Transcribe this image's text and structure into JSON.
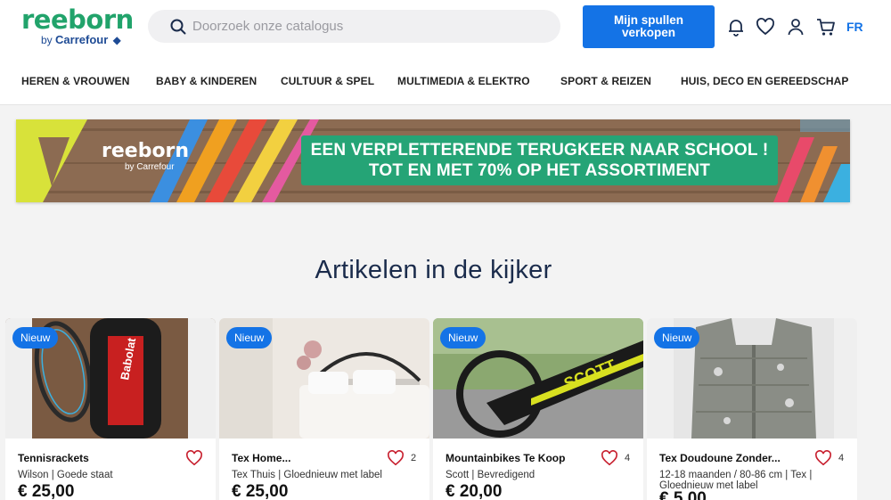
{
  "header": {
    "logo_main": "reeborn",
    "logo_by": "by",
    "logo_brand": "Carrefour",
    "search_placeholder": "Doorzoek onze catalogus",
    "sell_button": "Mijn spullen verkopen",
    "lang": "FR",
    "icons": [
      "bell-icon",
      "heart-icon",
      "user-icon",
      "cart-icon"
    ]
  },
  "nav": {
    "items": [
      "HEREN & VROUWEN",
      "BABY & KINDEREN",
      "CULTUUR & SPEL",
      "MULTIMEDIA & ELEKTRO",
      "SPORT & REIZEN",
      "HUIS, DECO EN GEREEDSCHAP"
    ]
  },
  "banner": {
    "logo_main": "reeborn",
    "logo_sub": "by Carrefour",
    "line1": "EEN VERPLETTERENDE TERUGKEER NAAR SCHOOL !",
    "line2": "TOT EN MET 70% OP HET ASSORTIMENT"
  },
  "section": {
    "title": "Artikelen in de kijker"
  },
  "products": [
    {
      "badge": "Nieuw",
      "title": "Tennisrackets",
      "subtitle": "Wilson | Goede staat",
      "price": "€ 25,00",
      "likes": ""
    },
    {
      "badge": "Nieuw",
      "title": "Tex Home...",
      "subtitle": "Tex Thuis | Gloednieuw met label",
      "price": "€ 25,00",
      "likes": "2"
    },
    {
      "badge": "Nieuw",
      "title": "Mountainbikes Te Koop",
      "subtitle": "Scott | Bevredigend",
      "price": "€ 20,00",
      "likes": "4"
    },
    {
      "badge": "Nieuw",
      "title": "Tex Doudoune Zonder...",
      "subtitle": "12-18 maanden / 80-86 cm | Tex | Gloednieuw met label",
      "price": "€ 5,00",
      "likes": "4"
    }
  ],
  "colors": {
    "brand_green": "#21a36b",
    "primary_blue": "#1473e6",
    "banner_green": "#25a476",
    "heading_navy": "#1a2b4b"
  }
}
